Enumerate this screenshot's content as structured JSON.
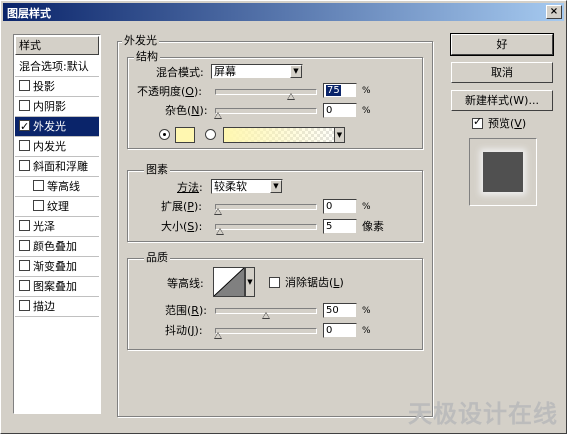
{
  "window": {
    "title": "图层样式",
    "close": "×"
  },
  "list": {
    "header": "样式",
    "items": [
      {
        "label": "混合选项:默认",
        "checkbox": false,
        "checked": false,
        "selected": false,
        "indent": false
      },
      {
        "label": "投影",
        "checkbox": true,
        "checked": false,
        "selected": false,
        "indent": false
      },
      {
        "label": "内阴影",
        "checkbox": true,
        "checked": false,
        "selected": false,
        "indent": false
      },
      {
        "label": "外发光",
        "checkbox": true,
        "checked": true,
        "selected": true,
        "indent": false
      },
      {
        "label": "内发光",
        "checkbox": true,
        "checked": false,
        "selected": false,
        "indent": false
      },
      {
        "label": "斜面和浮雕",
        "checkbox": true,
        "checked": false,
        "selected": false,
        "indent": false
      },
      {
        "label": "等高线",
        "checkbox": true,
        "checked": false,
        "selected": false,
        "indent": true
      },
      {
        "label": "纹理",
        "checkbox": true,
        "checked": false,
        "selected": false,
        "indent": true
      },
      {
        "label": "光泽",
        "checkbox": true,
        "checked": false,
        "selected": false,
        "indent": false
      },
      {
        "label": "颜色叠加",
        "checkbox": true,
        "checked": false,
        "selected": false,
        "indent": false
      },
      {
        "label": "渐变叠加",
        "checkbox": true,
        "checked": false,
        "selected": false,
        "indent": false
      },
      {
        "label": "图案叠加",
        "checkbox": true,
        "checked": false,
        "selected": false,
        "indent": false
      },
      {
        "label": "描边",
        "checkbox": true,
        "checked": false,
        "selected": false,
        "indent": false
      }
    ]
  },
  "panel": {
    "title": "外发光",
    "structure": {
      "title": "结构",
      "blend_mode_label": "混合模式:",
      "blend_mode_value": "屏幕",
      "opacity_label_pre": "不透明度(",
      "opacity_key": "O",
      "opacity_label_post": "):",
      "opacity_value": "75",
      "opacity_unit": "%",
      "opacity_level": 0.75,
      "noise_label_pre": "杂色(",
      "noise_key": "N",
      "noise_label_post": "):",
      "noise_value": "0",
      "noise_unit": "%",
      "noise_level": 0
    },
    "elements": {
      "title": "图素",
      "method_label_pre": "方法",
      "method_label_post": ":",
      "method_value": "较柔软",
      "spread_label_pre": "扩展(",
      "spread_key": "P",
      "spread_label_post": "):",
      "spread_value": "0",
      "spread_unit": "%",
      "size_label_pre": "大小(",
      "size_key": "S",
      "size_label_post": "):",
      "size_value": "5",
      "size_unit": "像素"
    },
    "quality": {
      "title": "品质",
      "contour_label": "等高线:",
      "anti_alias_pre": "消除锯齿(",
      "anti_alias_key": "L",
      "anti_alias_post": ")",
      "range_label_pre": "范围(",
      "range_key": "R",
      "range_label_post": "):",
      "range_value": "50",
      "range_unit": "%",
      "range_level": 0.5,
      "jitter_label_pre": "抖动(",
      "jitter_key": "J",
      "jitter_label_post": "):",
      "jitter_value": "0",
      "jitter_unit": "%"
    }
  },
  "buttons": {
    "ok": "好",
    "cancel": "取消",
    "new_style": "新建样式(W)...",
    "preview_pre": "预览(",
    "preview_key": "V",
    "preview_post": ")"
  },
  "colors": {
    "glow_color": "#fff7b0",
    "selection": "#0a246a"
  },
  "watermark": "天极设计在线"
}
